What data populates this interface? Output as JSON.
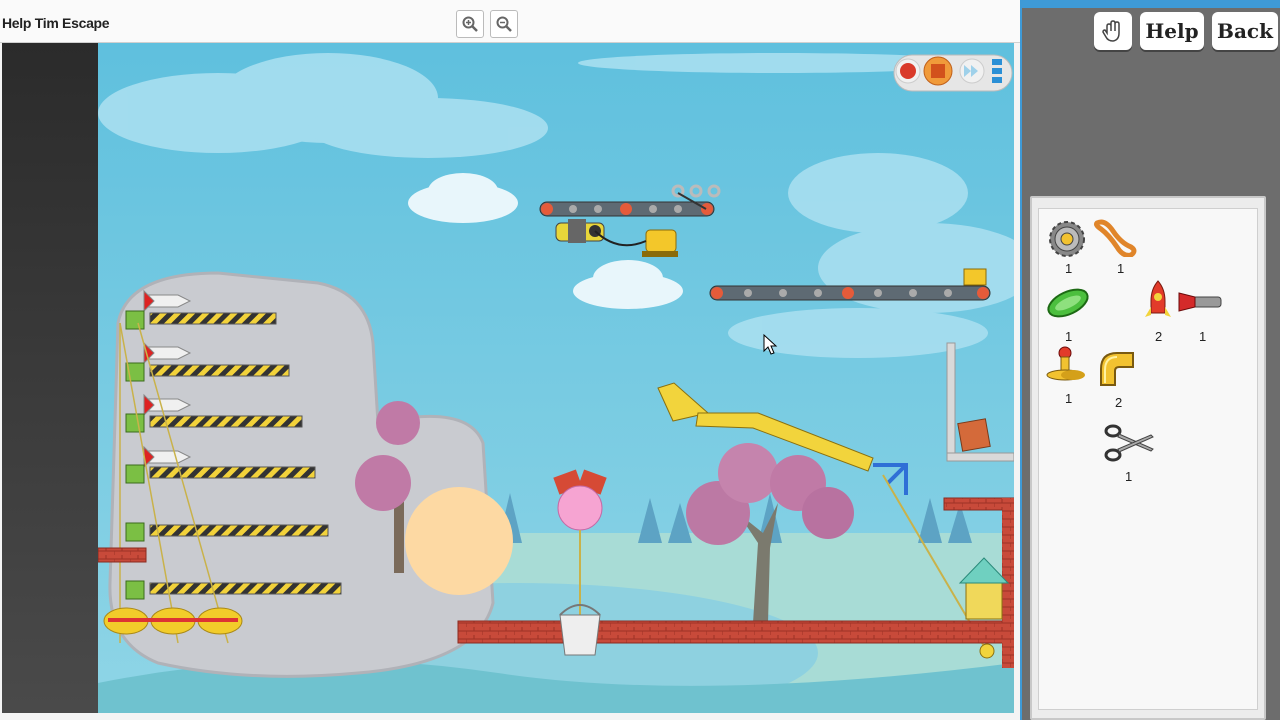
{
  "window": {
    "title": "Help Tim Escape",
    "zoom_in_icon": "zoom-in-icon",
    "zoom_out_icon": "zoom-out-icon"
  },
  "controls": {
    "record_icon": "record-icon",
    "stop_icon": "stop-icon",
    "fast_forward_icon": "fast-forward-icon",
    "speed_icon": "speed-bars-icon"
  },
  "toolbar": {
    "hand_icon": "hand-icon",
    "help_label": "Help",
    "back_label": "Back"
  },
  "parts_bin": {
    "items": [
      {
        "icon": "gear-icon",
        "count": "1"
      },
      {
        "icon": "rope-icon",
        "count": "1"
      },
      {
        "icon": "trampoline-icon",
        "count": "1"
      },
      {
        "icon": "rocket-icon",
        "count": "2"
      },
      {
        "icon": "flashlight-icon",
        "count": "1"
      },
      {
        "icon": "bellows-icon",
        "count": "1"
      },
      {
        "icon": "pipe-elbow-icon",
        "count": "2"
      },
      {
        "icon": "scissors-icon",
        "count": "1"
      }
    ]
  },
  "colors": {
    "accent": "#3e9ad7",
    "sky": "#6cc6e0",
    "brick": "#c84a3a",
    "conveyor": "#5e6a73"
  }
}
